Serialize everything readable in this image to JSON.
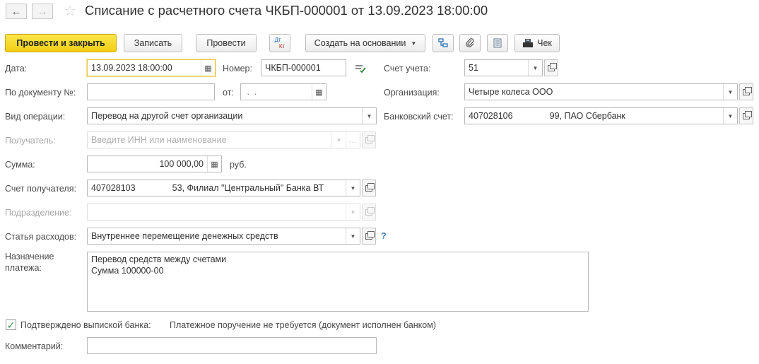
{
  "header": {
    "title": "Списание с расчетного счета ЧКБП-000001 от 13.09.2023 18:00:00"
  },
  "toolbar": {
    "post_and_close": "Провести и закрыть",
    "save": "Записать",
    "post": "Провести",
    "dt_label": "Дт",
    "kt_label": "Кт",
    "create_based_on": "Создать на основании",
    "receipt": "Чек"
  },
  "form": {
    "date": {
      "label": "Дата:",
      "value": "13.09.2023 18:00:00"
    },
    "number": {
      "label": "Номер:",
      "value": "ЧКБП-000001"
    },
    "account": {
      "label": "Счет учета:",
      "value": "51"
    },
    "doc_number": {
      "label": "По документу №:",
      "value": ""
    },
    "doc_from": {
      "label": "от:",
      "value": " .  ."
    },
    "organization": {
      "label": "Организация:",
      "value": "Четыре колеса ООО"
    },
    "operation": {
      "label": "Вид операции:",
      "value": "Перевод на другой счет организации"
    },
    "bank_account": {
      "label": "Банковский счет:",
      "value": "407028106               99, ПАО Сбербанк"
    },
    "recipient": {
      "label": "Получатель:",
      "placeholder": "Введите ИНН или наименование"
    },
    "amount": {
      "label": "Сумма:",
      "value": "100 000,00",
      "currency": "руб."
    },
    "recipient_account": {
      "label": "Счет получателя:",
      "value": "407028103               53, Филиал \"Центральный\" Банка ВТ"
    },
    "department": {
      "label": "Подразделение:",
      "value": ""
    },
    "expense_item": {
      "label": "Статья расходов:",
      "value": "Внутреннее перемещение денежных средств",
      "help": "?"
    },
    "purpose": {
      "label_line1": "Назначение",
      "label_line2": "платежа:",
      "line1": "Перевод средств между счетами",
      "line2": "Сумма 100000-00"
    },
    "confirmed": {
      "label": "Подтверждено выпиской банка:",
      "checked": true,
      "note": "Платежное поручение не требуется (документ исполнен банком)"
    },
    "comment": {
      "label": "Комментарий:",
      "value": ""
    }
  }
}
